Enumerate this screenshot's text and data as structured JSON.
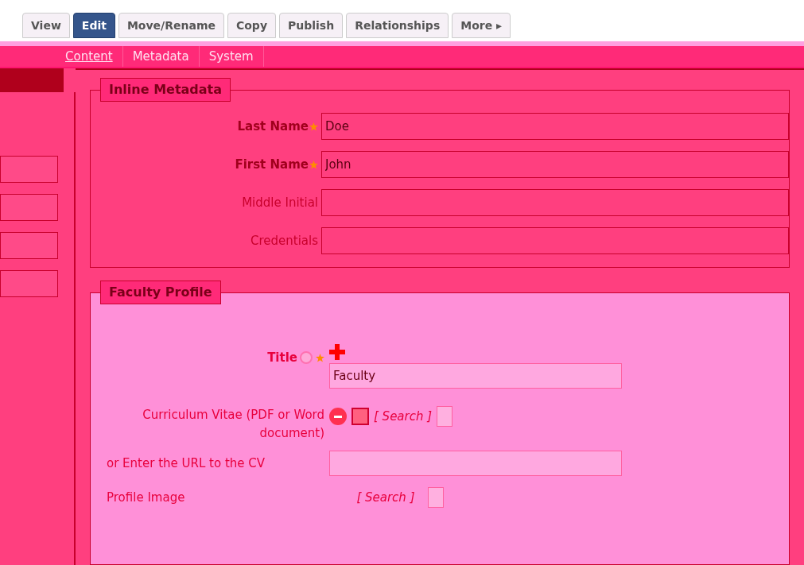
{
  "actions": [
    {
      "label": "View",
      "selected": false
    },
    {
      "label": "Edit",
      "selected": true
    },
    {
      "label": "Move/Rename",
      "selected": false
    },
    {
      "label": "Copy",
      "selected": false
    },
    {
      "label": "Publish",
      "selected": false
    },
    {
      "label": "Relationships",
      "selected": false
    },
    {
      "label": "More ▸",
      "selected": false
    }
  ],
  "tabs": [
    {
      "label": "Content",
      "selected": true
    },
    {
      "label": "Metadata",
      "selected": false
    },
    {
      "label": "System",
      "selected": false
    }
  ],
  "inline_metadata": {
    "legend": "Inline Metadata",
    "fields": [
      {
        "label": "Last Name",
        "required": true,
        "value": "Doe"
      },
      {
        "label": "First Name",
        "required": true,
        "value": "John"
      },
      {
        "label": "Middle Initial",
        "required": false
      },
      {
        "label": "Credentials",
        "required": false
      }
    ]
  },
  "faculty_profile": {
    "legend": "Faculty Profile",
    "title": {
      "label": "Title",
      "value": "Faculty"
    },
    "cv": {
      "label": "Curriculum Vitae (PDF or Word document)",
      "search": "[ Search ]"
    },
    "cv_url": {
      "label": "or Enter the URL to the CV"
    },
    "image": {
      "label": "Profile Image",
      "search": "[ Search ]"
    }
  }
}
